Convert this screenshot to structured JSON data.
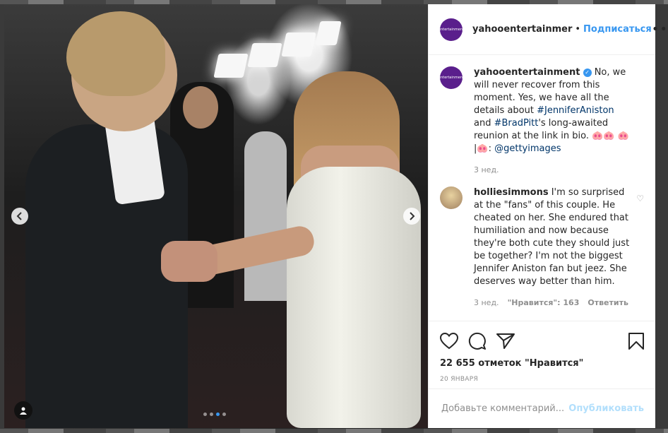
{
  "colors": {
    "accent": "#3897f0",
    "avatar_bg": "#5a1f8c",
    "muted": "#8e8e8e",
    "post_disabled": "#b2dffc"
  },
  "photo": {
    "prev_icon": "chevron-left-icon",
    "next_icon": "chevron-right-icon",
    "tag_icon": "user-tag-icon",
    "carousel": {
      "count": 4,
      "active": 3
    }
  },
  "header": {
    "username": "yahooentertainmer",
    "separator": "•",
    "follow_label": "Подписаться",
    "more_label": "•••"
  },
  "caption": {
    "avatar_text": "entertainment",
    "username": "yahooentertainment",
    "verified_icon": "✓",
    "text_before": " No, we will never recover from this moment. Yes, we have all the details about ",
    "tag1": "#JenniferAniston",
    "text_mid": " and ",
    "tag2": "#BradPitt",
    "text_after": "'s long-awaited reunion at the link in bio. 🐽🐽 🐽 |🐽: ",
    "mention": "@gettyimages",
    "time": "3 нед."
  },
  "comment": {
    "username": "holliesimmons",
    "text": " I'm so surprised at the \"fans\" of this couple. He cheated on her. She endured that humiliation and now because they're both cute they should just be together? I'm not the biggest Jennifer Aniston fan but jeez. She deserves way better than him.",
    "time": "3 нед.",
    "likes": "\"Нравится\": 163",
    "reply_label": "Ответить",
    "heart_icon": "♡"
  },
  "actions": {
    "like_icon": "heart-icon",
    "comment_icon": "comment-icon",
    "share_icon": "share-icon",
    "save_icon": "bookmark-icon",
    "likes_count": "22 655 отметок \"Нравится\"",
    "date": "20 ЯНВАРЯ"
  },
  "add_comment": {
    "placeholder": "Добавьте комментарий...",
    "post_label": "Опубликовать"
  }
}
